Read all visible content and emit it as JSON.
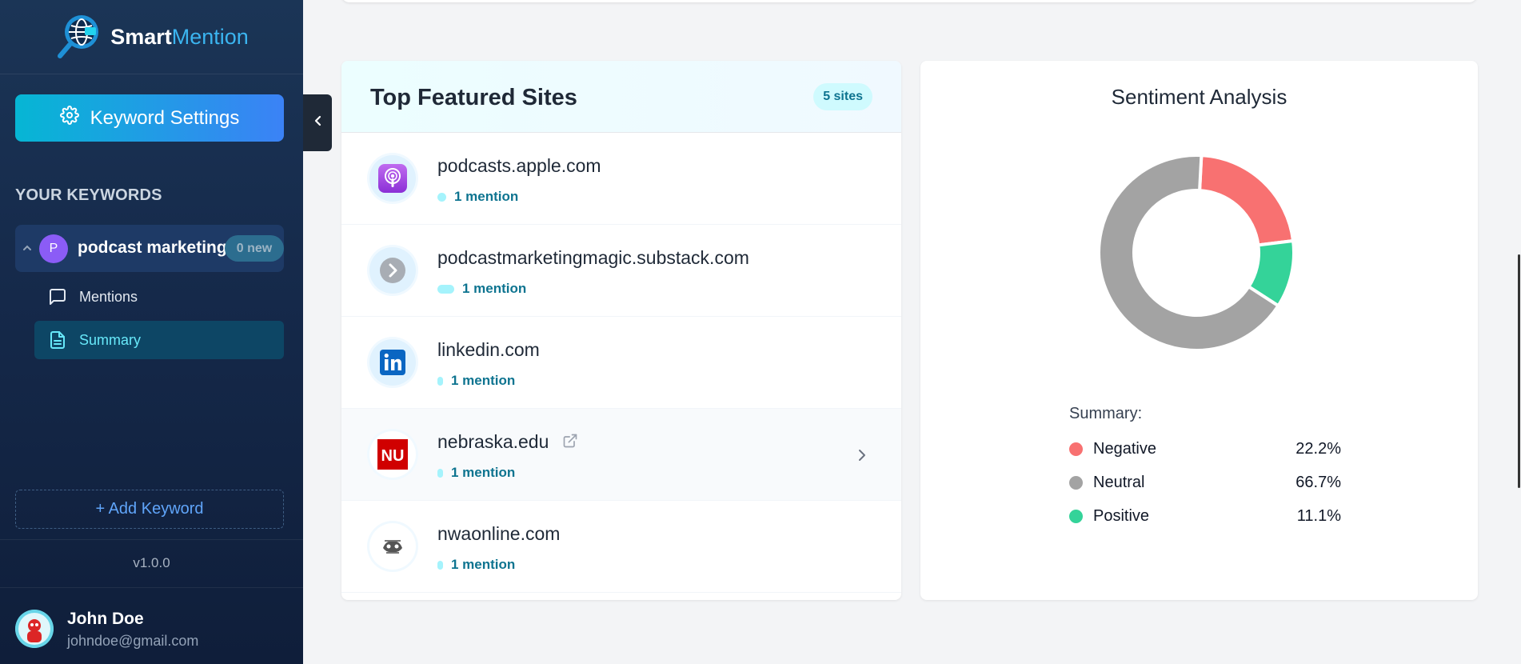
{
  "brand": {
    "name_part1": "Smart",
    "name_part2": "Mention"
  },
  "sidebar": {
    "keyword_settings_label": "Keyword Settings",
    "your_keywords_heading": "YOUR KEYWORDS",
    "keyword": {
      "avatar_letter": "P",
      "name": "podcast marketing",
      "badge": "0 new"
    },
    "sub_items": [
      {
        "label": "Mentions",
        "icon": "message-square-icon"
      },
      {
        "label": "Summary",
        "icon": "file-text-icon",
        "active": true
      }
    ],
    "add_keyword_label": "+ Add Keyword",
    "version": "v1.0.0",
    "user": {
      "name": "John Doe",
      "email": "johndoe@gmail.com"
    }
  },
  "featured_sites": {
    "title": "Top Featured Sites",
    "count_badge": "5 sites",
    "sites": [
      {
        "domain": "podcasts.apple.com",
        "mentions": "1 mention",
        "icon": "apple-podcasts-icon"
      },
      {
        "domain": "podcastmarketingmagic.substack.com",
        "mentions": "1 mention",
        "icon": "chevron-right-circle-icon"
      },
      {
        "domain": "linkedin.com",
        "mentions": "1 mention",
        "icon": "linkedin-icon"
      },
      {
        "domain": "nebraska.edu",
        "mentions": "1 mention",
        "icon": "nu-logo-icon",
        "hovered": true
      },
      {
        "domain": "nwaonline.com",
        "mentions": "1 mention",
        "icon": "nwaonline-logo-icon"
      }
    ]
  },
  "sentiment": {
    "title": "Sentiment Analysis",
    "summary_label": "Summary:",
    "items": [
      {
        "label": "Negative",
        "percent": "22.2%",
        "value": 22.2,
        "color": "#f87171"
      },
      {
        "label": "Neutral",
        "percent": "66.7%",
        "value": 66.7,
        "color": "#a3a3a3"
      },
      {
        "label": "Positive",
        "percent": "11.1%",
        "value": 11.1,
        "color": "#34d399"
      }
    ]
  },
  "colors": {
    "accent": "#06b6d4",
    "sidebar_bg": "#15294a",
    "mention_text": "#0e7490"
  }
}
